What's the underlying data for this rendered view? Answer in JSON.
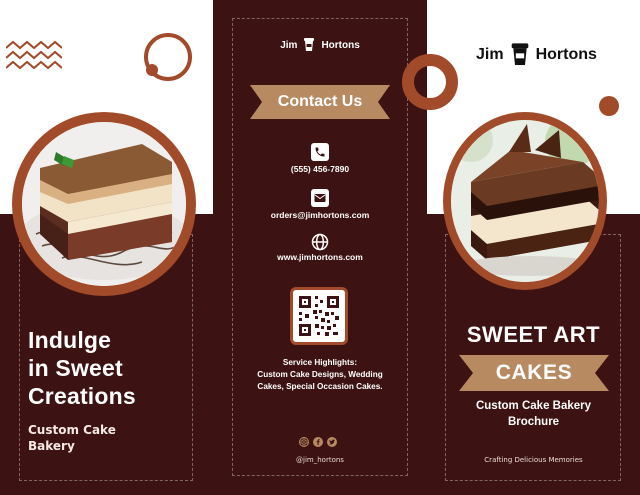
{
  "brand": {
    "word1": "Jim",
    "word2": "Hortons"
  },
  "left": {
    "title_lines": [
      "Indulge",
      "in Sweet",
      "Creations"
    ],
    "subtitle_lines": [
      "Custom Cake",
      "Bakery"
    ]
  },
  "middle": {
    "banner": "Contact Us",
    "phone": "(555) 456-7890",
    "email": "orders@jimhortons.com",
    "website": "www.jimhortons.com",
    "highlights_lines": [
      "Service Highlights:",
      "Custom Cake Designs, Wedding",
      "Cakes, Special Occasion Cakes."
    ],
    "handle": "@jim_hortons"
  },
  "right": {
    "title": "SWEET ART",
    "banner": "CAKES",
    "subtitle_lines": [
      "Custom Cake Bakery",
      "Brochure"
    ],
    "tagline": "Crafting Delicious Memories"
  },
  "colors": {
    "brown": "#3d1212",
    "terracotta": "#a14b2a",
    "tan": "#b88a62"
  },
  "icons": [
    "phone-icon",
    "email-icon",
    "globe-icon",
    "qr-code-icon",
    "instagram-icon",
    "facebook-icon",
    "twitter-icon",
    "cup-icon",
    "zigzag-decoration"
  ]
}
